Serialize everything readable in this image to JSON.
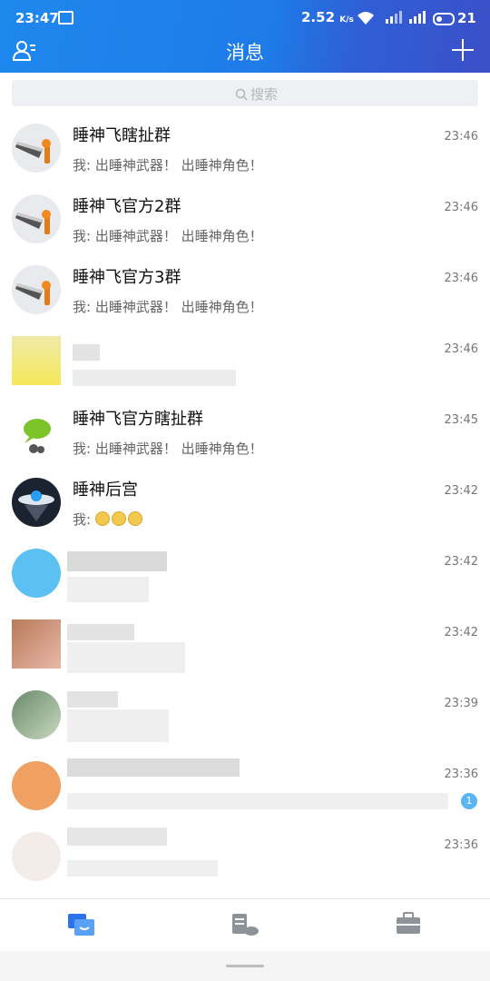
{
  "status_bar": {
    "time": "23:47",
    "speed": "2.52",
    "speed_unit": "K/s",
    "battery": "21"
  },
  "header": {
    "title": "消息"
  },
  "search": {
    "placeholder": "搜索"
  },
  "conversations": [
    {
      "name": "睡神飞瞎扯群",
      "preview": "我: 出睡神武器！ 出睡神角色！",
      "time": "23:46",
      "avatar": "sword-avatar"
    },
    {
      "name": "睡神飞官方2群",
      "preview": "我: 出睡神武器！ 出睡神角色！",
      "time": "23:46",
      "avatar": "sword-avatar"
    },
    {
      "name": "睡神飞官方3群",
      "preview": "我: 出睡神武器！ 出睡神角色！",
      "time": "23:46",
      "avatar": "sword-avatar"
    },
    {
      "name": "",
      "preview": "",
      "time": "23:46",
      "avatar": "blurred-avatar"
    },
    {
      "name": "睡神飞官方瞎扯群",
      "preview": "我: 出睡神武器！ 出睡神角色！",
      "time": "23:45",
      "avatar": "leaf-avatar"
    },
    {
      "name": "睡神后宫",
      "preview": "我: ",
      "time": "23:42",
      "avatar": "ufo-avatar",
      "emoji_count": 3
    },
    {
      "name": "",
      "preview": "",
      "time": "23:42",
      "avatar": "blurred-avatar"
    },
    {
      "name": "",
      "preview": "",
      "time": "23:42",
      "avatar": "blurred-avatar"
    },
    {
      "name": "",
      "preview": "",
      "time": "23:39",
      "avatar": "blurred-avatar"
    },
    {
      "name": "",
      "preview": "",
      "time": "23:36",
      "avatar": "blurred-avatar",
      "unread": "1"
    },
    {
      "name": "",
      "preview": "",
      "time": "23:36",
      "avatar": "blurred-avatar"
    }
  ],
  "tabs": [
    {
      "icon": "messages-icon",
      "active": true
    },
    {
      "icon": "documents-cloud-icon",
      "active": false
    },
    {
      "icon": "briefcase-icon",
      "active": false
    }
  ],
  "colors": {
    "accent": "#1e88ee",
    "tab_active": "#2b73e8",
    "tab_inactive": "#8e9299"
  }
}
